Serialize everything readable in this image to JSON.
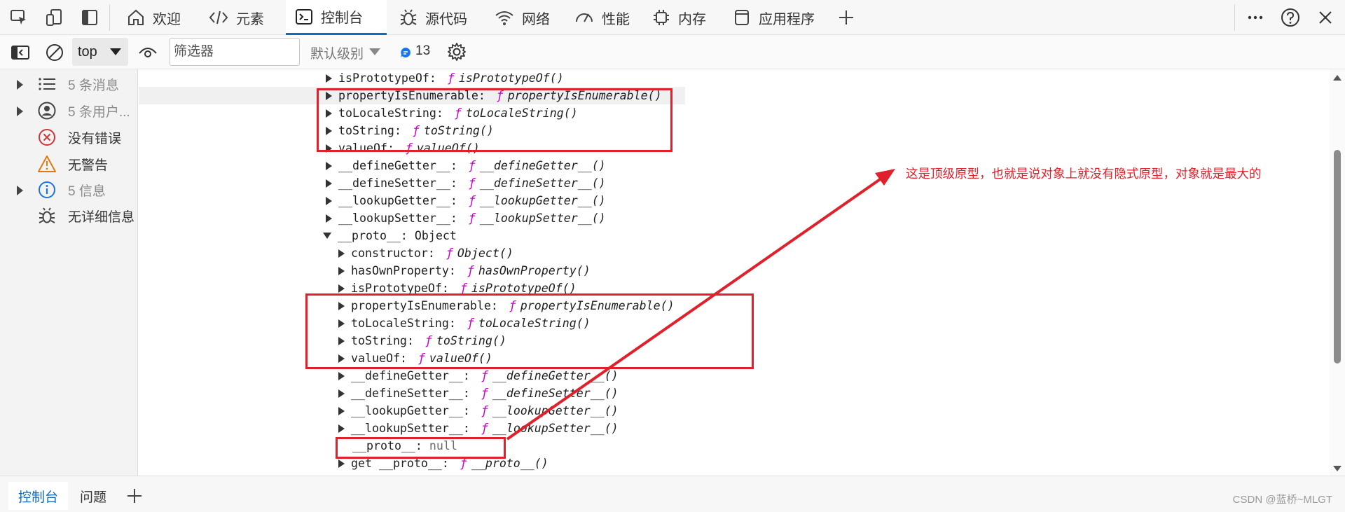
{
  "tabs": [
    {
      "label": "欢迎",
      "icon": "home-icon"
    },
    {
      "label": "元素",
      "icon": "code-icon"
    },
    {
      "label": "控制台",
      "icon": "console-icon"
    },
    {
      "label": "源代码",
      "icon": "bug-icon"
    },
    {
      "label": "网络",
      "icon": "wifi-icon"
    },
    {
      "label": "性能",
      "icon": "gauge-icon"
    },
    {
      "label": "内存",
      "icon": "chip-icon"
    },
    {
      "label": "应用程序",
      "icon": "app-icon"
    }
  ],
  "toolbar": {
    "context": "top",
    "filter_placeholder": "筛选器",
    "level": "默认级别",
    "message_count": "13"
  },
  "sidebar": {
    "items": [
      {
        "label": "5 条消息",
        "icon": "list-icon"
      },
      {
        "label": "5 条用户...",
        "icon": "user-icon"
      },
      {
        "label": "没有错误",
        "icon": "error-icon"
      },
      {
        "label": "无警告",
        "icon": "warning-icon"
      },
      {
        "label": "5 信息",
        "icon": "info-icon"
      },
      {
        "label": "无详细信息",
        "icon": "verbose-bug-icon"
      }
    ]
  },
  "console": {
    "rows": [
      {
        "key": "isPrototypeOf",
        "f": "ƒ",
        "val": "isPrototypeOf()"
      },
      {
        "key": "propertyIsEnumerable",
        "f": "ƒ",
        "val": "propertyIsEnumerable()"
      },
      {
        "key": "toLocaleString",
        "f": "ƒ",
        "val": "toLocaleString()"
      },
      {
        "key": "toString",
        "f": "ƒ",
        "val": "toString()"
      },
      {
        "key": "valueOf",
        "f": "ƒ",
        "val": "valueOf()"
      },
      {
        "key": "__defineGetter__",
        "f": "ƒ",
        "val": "__defineGetter__()"
      },
      {
        "key": "__defineSetter__",
        "f": "ƒ",
        "val": "__defineSetter__()"
      },
      {
        "key": "__lookupGetter__",
        "f": "ƒ",
        "val": "__lookupGetter__()"
      },
      {
        "key": "__lookupSetter__",
        "f": "ƒ",
        "val": "__lookupSetter__()"
      },
      {
        "key": "__proto__",
        "plain": "Object"
      },
      {
        "key": "constructor",
        "f": "ƒ",
        "val": "Object()"
      },
      {
        "key": "hasOwnProperty",
        "f": "ƒ",
        "val": "hasOwnProperty()"
      },
      {
        "key": "isPrototypeOf",
        "f": "ƒ",
        "val": "isPrototypeOf()"
      },
      {
        "key": "propertyIsEnumerable",
        "f": "ƒ",
        "val": "propertyIsEnumerable()"
      },
      {
        "key": "toLocaleString",
        "f": "ƒ",
        "val": "toLocaleString()"
      },
      {
        "key": "toString",
        "f": "ƒ",
        "val": "toString()"
      },
      {
        "key": "valueOf",
        "f": "ƒ",
        "val": "valueOf()"
      },
      {
        "key": "__defineGetter__",
        "f": "ƒ",
        "val": "__defineGetter__()"
      },
      {
        "key": "__defineSetter__",
        "f": "ƒ",
        "val": "__defineSetter__()"
      },
      {
        "key": "__lookupGetter__",
        "f": "ƒ",
        "val": "__lookupGetter__()"
      },
      {
        "key": "__lookupSetter__",
        "f": "ƒ",
        "val": "__lookupSetter__()"
      },
      {
        "key": "__proto__",
        "plain": "null"
      },
      {
        "key": "get __proto__",
        "f": "ƒ",
        "val": "__proto__()"
      }
    ]
  },
  "annotation": {
    "text": "这是顶级原型，也就是说对象上就没有隐式原型，对象就是最大的"
  },
  "bottom": {
    "tabs": [
      "控制台",
      "问题"
    ],
    "watermark": "CSDN @蓝桥~MLGT"
  },
  "colors": {
    "accent": "#0f6cbd",
    "annotation": "#e0202a",
    "function_symbol": "#c800c8"
  }
}
